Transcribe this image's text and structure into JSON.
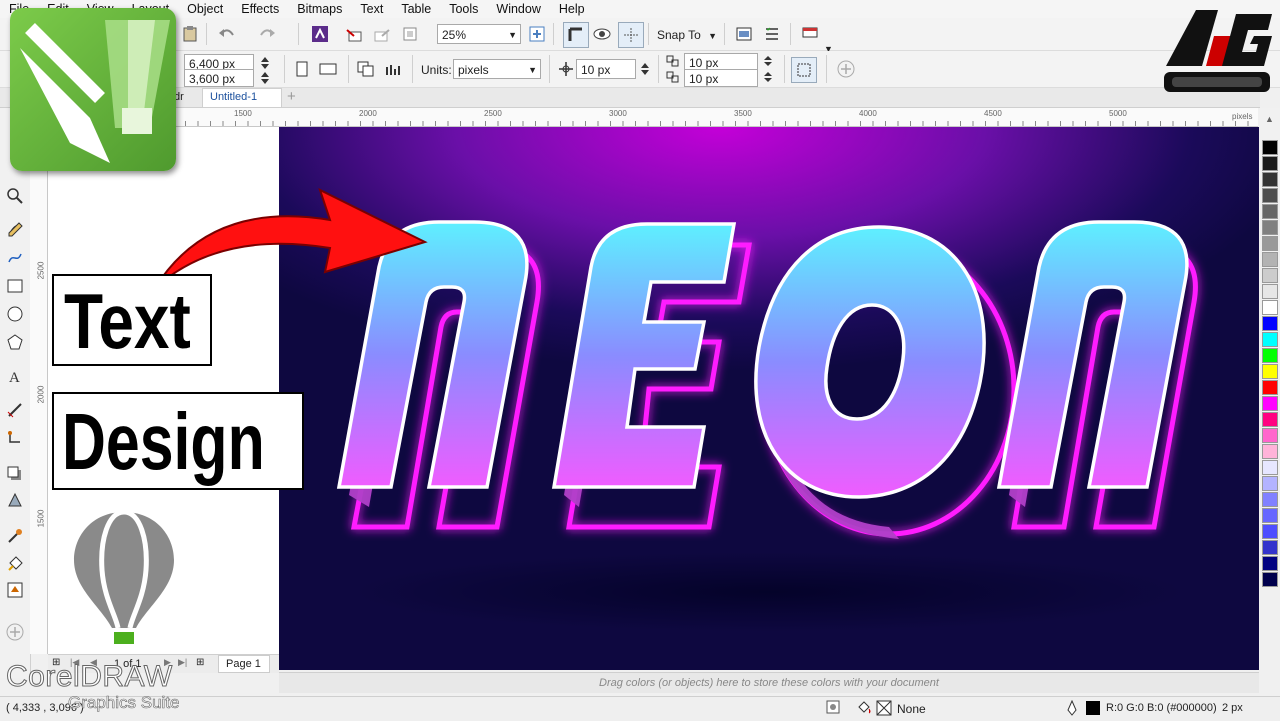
{
  "menu": [
    "File",
    "Edit",
    "View",
    "Layout",
    "Object",
    "Effects",
    "Bitmaps",
    "Text",
    "Table",
    "Tools",
    "Window",
    "Help"
  ],
  "toolbar": {
    "zoom": "25%",
    "snap_to": "Snap To",
    "width": "6,400 px",
    "height": "3,600 px",
    "units_label": "Units:",
    "units_value": "pixels",
    "nudge": "10 px",
    "dup_x": "10 px",
    "dup_y": "10 px"
  },
  "tabs": [
    "dr",
    "Untitled-1"
  ],
  "ruler": {
    "h_ticks": [
      "1500",
      "2000",
      "2500",
      "3000",
      "3500",
      "4000",
      "4500",
      "5000"
    ],
    "unit": "pixels",
    "v_ticks": [
      "2500",
      "2000",
      "1500"
    ]
  },
  "overlay": {
    "word1": "Text",
    "word2": "Design",
    "brand_main": "CorelDRAW",
    "brand_sub": "Graphics Suite"
  },
  "page_nav": {
    "counter": "1 of 1",
    "page_tab": "Page 1"
  },
  "dropbar": "Drag colors (or objects) here to store these colors with your document",
  "status": {
    "coords": "( 4,333 , 3,096 )",
    "fill": "None",
    "outline_color": "R:0 G:0 B:0 (#000000)",
    "outline_width": "2 px"
  },
  "palette_colors": [
    "#000000",
    "#1a1a1a",
    "#333333",
    "#4d4d4d",
    "#666666",
    "#808080",
    "#999999",
    "#b3b3b3",
    "#cccccc",
    "#e6e6e6",
    "#ffffff",
    "#0000ff",
    "#00ffff",
    "#00ff00",
    "#ffff00",
    "#ff0000",
    "#ff00ff",
    "#ff0080",
    "#ff66cc",
    "#ffb3d9",
    "#e6e6ff",
    "#b3b3ff",
    "#8080ff",
    "#6666ff",
    "#4d4dff",
    "#3333cc",
    "#000080",
    "#00004d"
  ],
  "colors": {
    "neon_pink": "#ff1aff",
    "neon_cyan": "#39e6ff",
    "arrow_red": "#ff1010",
    "corel_green": "#6db33f"
  }
}
